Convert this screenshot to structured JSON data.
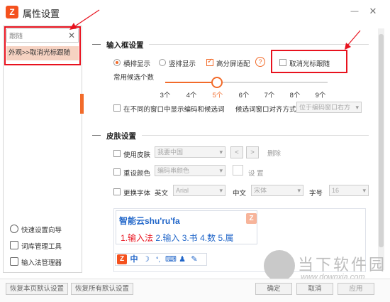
{
  "window": {
    "title": "属性设置",
    "logo_glyph": "Z",
    "minimize_glyph": "—",
    "close_glyph": "✕"
  },
  "sidebar": {
    "search": {
      "value": "跟随",
      "clear_glyph": "✕"
    },
    "results": [
      {
        "label": "外观>>取消光标跟随",
        "selected": true
      }
    ],
    "bottom_links": [
      {
        "label": "快速设置向导",
        "icon": "refresh-icon"
      },
      {
        "label": "词库管理工具",
        "icon": "dictionary-icon"
      },
      {
        "label": "输入法管理器",
        "icon": "manager-icon"
      }
    ]
  },
  "input_box_section": {
    "title": "输入框设置",
    "layout_options": [
      {
        "label": "横排显示",
        "checked": true
      },
      {
        "label": "竖排显示",
        "checked": false
      }
    ],
    "hidpi": {
      "label": "高分屏适配",
      "checked": true,
      "help_glyph": "?"
    },
    "cancel_follow": {
      "label": "取消光标跟随",
      "checked": false
    },
    "candidates": {
      "label": "常用候选个数",
      "ticks": [
        "3个",
        "4个",
        "5个",
        "6个",
        "7个",
        "8个",
        "9个"
      ],
      "selected": "5个",
      "value": 5
    },
    "show_code_other_window": {
      "label": "在不同的窗口中显示编码和候选词",
      "checked": false
    },
    "align": {
      "label": "候选词窗口对齐方式",
      "value": "位于编码窗口右方"
    }
  },
  "skin_section": {
    "title": "皮肤设置",
    "use_skin": {
      "label": "使用皮肤",
      "value": "我要中国",
      "delete_label": "删除",
      "prev_glyph": "<",
      "next_glyph": ">"
    },
    "recolor": {
      "label": "重设颜色",
      "value": "编码串颜色",
      "settings_label": "设 置"
    },
    "font": {
      "label": "更换字体",
      "en_label": "英文",
      "en_value": "Arial",
      "zh_label": "中文",
      "zh_value": "宋体",
      "size_label": "字号",
      "size_value": "16"
    }
  },
  "preview": {
    "composition": "智能云shu'ru'fa",
    "badge_glyph": "Z",
    "candidates": [
      {
        "text": "1.输入法",
        "color": "#e8121e"
      },
      {
        "text": "2.输入",
        "color": "#2166c9"
      },
      {
        "text": "3.书",
        "color": "#2166c9"
      },
      {
        "text": "4.数",
        "color": "#2166c9"
      },
      {
        "text": "5.属",
        "color": "#2166c9"
      }
    ],
    "toolbar": [
      {
        "glyph": "Z",
        "icon": "app-logo-icon"
      },
      {
        "glyph": "中",
        "icon": "chinese-mode-icon"
      },
      {
        "glyph": "☽",
        "icon": "half-width-icon"
      },
      {
        "glyph": "°,",
        "icon": "punctuation-icon"
      },
      {
        "glyph": "⌨",
        "icon": "keyboard-icon"
      },
      {
        "glyph": "♟",
        "icon": "user-icon"
      },
      {
        "glyph": "✎",
        "icon": "tools-icon"
      }
    ]
  },
  "footer": {
    "restore_page": "恢复本页默认设置",
    "restore_all": "恢复所有默认设置",
    "ok": "确定",
    "cancel": "取消",
    "apply": "应用"
  },
  "watermark": {
    "title": "当下软件园",
    "url": "www.downxia.com"
  },
  "colors": {
    "accent": "#f26b2a",
    "highlight": "#e8121e",
    "link": "#2166c9"
  }
}
